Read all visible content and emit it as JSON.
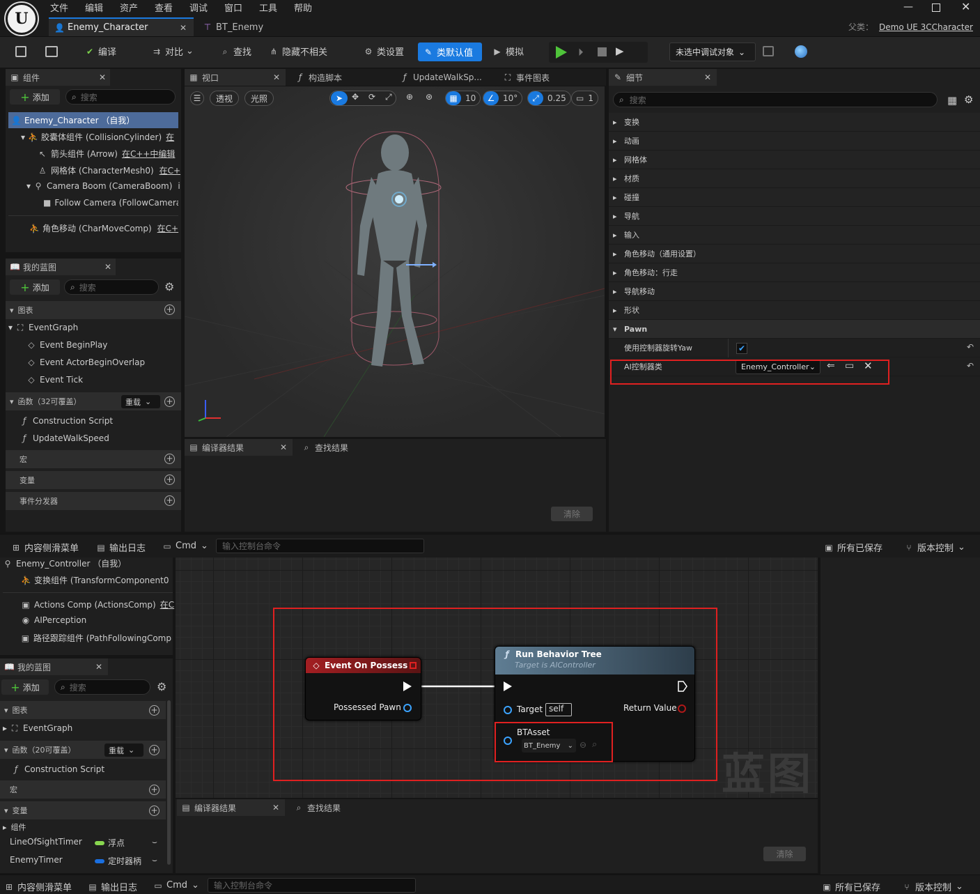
{
  "menu": [
    "文件",
    "编辑",
    "资产",
    "查看",
    "调试",
    "窗口",
    "工具",
    "帮助"
  ],
  "tabs": {
    "active": "Enemy_Character",
    "other": "BT_Enemy",
    "parent_label": "父类：",
    "parent_value": "Demo UE 3CCharacter"
  },
  "toolbar": {
    "compile": "编译",
    "diff": "对比",
    "find": "查找",
    "hide": "隐藏不相关",
    "class_settings": "类设置",
    "class_defaults": "类默认值",
    "simulate": "模拟",
    "debug_target": "未选中调试对象"
  },
  "components_panel": {
    "title": "组件",
    "add": "添加",
    "search_placeholder": "搜索",
    "items": [
      "Enemy_Character （自我）",
      "胶囊体组件 (CollisionCylinder)",
      "箭头组件 (Arrow)",
      "网格体 (CharacterMesh0)",
      "Camera Boom (CameraBoom)",
      "Follow Camera (FollowCamera",
      "角色移动 (CharMoveComp)"
    ],
    "suffixes": [
      "在",
      "在C++中编辑",
      "在C+",
      "i",
      "",
      "在C+"
    ]
  },
  "my_blueprint": {
    "title": "我的蓝图",
    "add": "添加",
    "search_placeholder": "搜索",
    "graphs": "图表",
    "event_graph": "EventGraph",
    "events": [
      "Event BeginPlay",
      "Event ActorBeginOverlap",
      "Event Tick"
    ],
    "functions": "函数（32可覆盖）",
    "override": "重载",
    "function_items": [
      "Construction Script",
      "UpdateWalkSpeed"
    ],
    "macros": "宏",
    "variables": "变量",
    "dispatchers": "事件分发器"
  },
  "viewport": {
    "tabs": [
      "视口",
      "构造脚本",
      "UpdateWalkSp...",
      "事件图表"
    ],
    "perspective": "透视",
    "lit": "光照",
    "grid": "10",
    "angle": "10°",
    "scale": "0.25",
    "cam": "1"
  },
  "compiler": {
    "tab": "编译器结果",
    "find": "查找结果",
    "clear": "清除"
  },
  "details": {
    "title": "细节",
    "search_placeholder": "搜索",
    "categories": [
      "变换",
      "动画",
      "网格体",
      "材质",
      "碰撞",
      "导航",
      "输入",
      "角色移动（通用设置）",
      "角色移动：行走",
      "导航移动",
      "形状"
    ],
    "pawn": "Pawn",
    "use_ctrl_yaw": "使用控制器旋转Yaw",
    "ai_ctrl_class": "AI控制器类",
    "ai_ctrl_value": "Enemy_Controller"
  },
  "statusbar": {
    "content_drawer": "内容侧滑菜单",
    "output_log": "输出日志",
    "cmd": "Cmd",
    "console_placeholder": "输入控制台命令",
    "saved": "所有已保存",
    "source_control": "版本控制"
  },
  "bottom_components": {
    "items": [
      "Enemy_Controller （自我）",
      "变换组件 (TransformComponent0",
      "Actions Comp (ActionsComp)",
      "AIPerception",
      "路径跟踪组件 (PathFollowingComp"
    ],
    "suffix": "在C"
  },
  "bottom_my_blueprint": {
    "title": "我的蓝图",
    "add": "添加",
    "search_placeholder": "搜索",
    "graphs": "图表",
    "event_graph": "EventGraph",
    "functions": "函数（20可覆盖）",
    "override": "重载",
    "construction": "Construction Script",
    "macros": "宏",
    "variables": "变量",
    "group": "组件",
    "vars": [
      {
        "name": "LineOfSightTimer",
        "type": "浮点",
        "color": "#88d64f"
      },
      {
        "name": "EnemyTimer",
        "type": "定时器柄",
        "color": "#1a6fe0"
      }
    ]
  },
  "graph": {
    "event_node": {
      "title": "Event On Possess",
      "pin": "Possessed Pawn"
    },
    "call_node": {
      "title": "Run Behavior Tree",
      "subtitle": "Target is AIController",
      "target": "Target",
      "self": "self",
      "return": "Return Value",
      "bt_label": "BTAsset",
      "bt_value": "BT_Enemy"
    },
    "watermark": "蓝图"
  },
  "colors": {
    "accent": "#1a7ae0",
    "highlight": "#e02020",
    "play": "#4fc43a"
  }
}
